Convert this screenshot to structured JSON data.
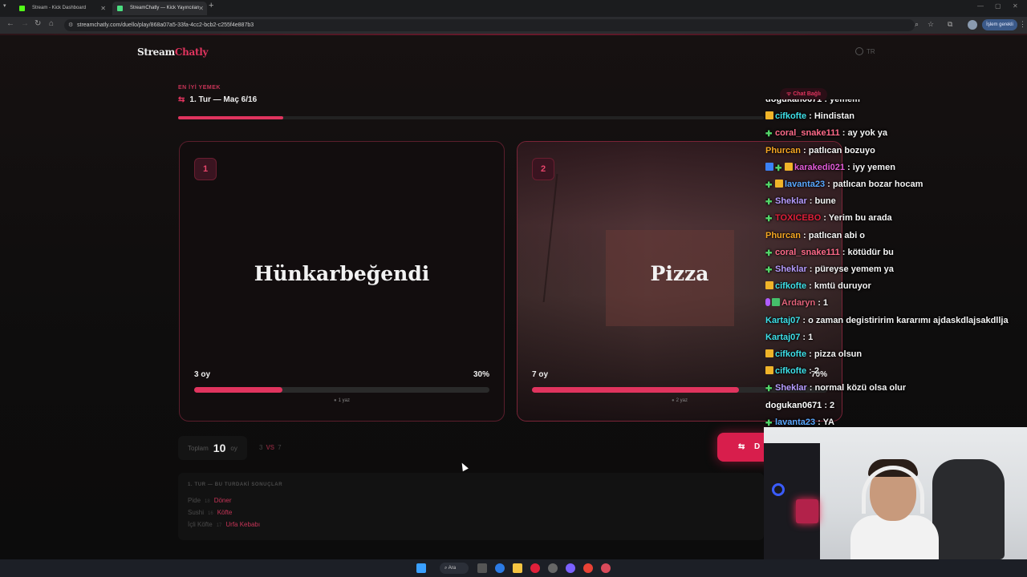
{
  "browser": {
    "tabs": [
      {
        "title": "Stream - Kick Dashboard",
        "active": false,
        "favicon_color": "#53fc18"
      },
      {
        "title": "StreamChatly — Kick Yayıncıları",
        "active": true,
        "favicon_color": "#4ade80"
      }
    ],
    "url": "streamchatly.com/duello/play/868a07a5-33fa-4cc2-bcb2-c255f4e887b3",
    "profile_button": "İşlem gerekli"
  },
  "app": {
    "logo_main": "Stream",
    "logo_accent": "Chatly",
    "language": "TR"
  },
  "duel": {
    "category": "EN İYİ YEMEK",
    "round_label": "1. Tur — Maç 6/16",
    "progress": 0.18,
    "options": [
      {
        "index": "1",
        "name": "Hünkarbeğendi",
        "votes": "3 oy",
        "percent": "30%",
        "fill": 0.3,
        "hint": "1 yaz"
      },
      {
        "index": "2",
        "name": "Pizza",
        "votes": "7 oy",
        "percent": "70%",
        "fill": 0.7,
        "hint": "2 yaz"
      }
    ],
    "total_label": "Toplam",
    "total_value": "10",
    "total_unit": "oy",
    "vs_left": "3",
    "vs_text": "VS",
    "vs_right": "7",
    "next_button": "D"
  },
  "results": {
    "heading": "1. TUR — BU TURDAKİ SONUÇLAR",
    "rows": [
      {
        "loser": "Pide",
        "score": "18",
        "winner": "Döner"
      },
      {
        "loser": "Sushi",
        "score": "16",
        "winner": "Köfte"
      },
      {
        "loser": "İçli Köfte",
        "score": "17",
        "winner": "Urfa Kebabı"
      }
    ]
  },
  "chat": {
    "status": "Chat Bağlı",
    "messages": [
      {
        "user": "dogukan0671",
        "text": ": yemem",
        "color": "#ffffff",
        "badges": []
      },
      {
        "user": "cifkofte",
        "text": ": Hindistan",
        "color": "#3ee0e8",
        "badges": [
          "sub"
        ]
      },
      {
        "user": "coral_snake111",
        "text": ": ay yok ya",
        "color": "#ff6b8a",
        "badges": [
          "plus"
        ]
      },
      {
        "user": "Phurcan",
        "text": ": patlıcan bozuyo",
        "color": "#f5a623",
        "badges": []
      },
      {
        "user": "karakedi021",
        "text": ": iyy yemen",
        "color": "#e25bd8",
        "badges": [
          "blue",
          "plus",
          "sub"
        ]
      },
      {
        "user": "lavanta23",
        "text": ": patlıcan bozar hocam",
        "color": "#5aa8ff",
        "badges": [
          "plus",
          "sub"
        ]
      },
      {
        "user": "Sheklar",
        "text": ": bune",
        "color": "#b79cff",
        "badges": [
          "plus"
        ]
      },
      {
        "user": "TOXICEBO",
        "text": ": Yerim bu arada",
        "color": "#e0203a",
        "badges": [
          "plus"
        ]
      },
      {
        "user": "Phurcan",
        "text": ": patlıcan abi o",
        "color": "#f5a623",
        "badges": []
      },
      {
        "user": "coral_snake111",
        "text": ": kötüdür bu",
        "color": "#ff6b8a",
        "badges": [
          "plus"
        ]
      },
      {
        "user": "Sheklar",
        "text": ": püreyse yemem ya",
        "color": "#b79cff",
        "badges": [
          "plus"
        ]
      },
      {
        "user": "cifkofte",
        "text": ": kmtü duruyor",
        "color": "#3ee0e8",
        "badges": [
          "sub"
        ]
      },
      {
        "user": "Ardaryn",
        "text": ": 1",
        "color": "#e2637a",
        "badges": [
          "mic",
          "green"
        ]
      },
      {
        "user": "Kartaj07",
        "text": ": o zaman degistiririm kararımı ajdaskdlajsakdllja",
        "color": "#3ee0e8",
        "badges": []
      },
      {
        "user": "Kartaj07",
        "text": ": 1",
        "color": "#3ee0e8",
        "badges": []
      },
      {
        "user": "cifkofte",
        "text": ": pizza olsun",
        "color": "#3ee0e8",
        "badges": [
          "sub"
        ]
      },
      {
        "user": "cifkofte",
        "text": ": 2",
        "color": "#3ee0e8",
        "badges": [
          "sub"
        ]
      },
      {
        "user": "Sheklar",
        "text": ": normal közü olsa olur",
        "color": "#b79cff",
        "badges": [
          "plus"
        ]
      },
      {
        "user": "dogukan0671",
        "text": ": 2",
        "color": "#ffffff",
        "badges": []
      },
      {
        "user": "lavanta23",
        "text": ": YA",
        "color": "#5aa8ff",
        "badges": [
          "plus"
        ]
      }
    ]
  },
  "taskbar": {
    "search_label": "Ara"
  }
}
